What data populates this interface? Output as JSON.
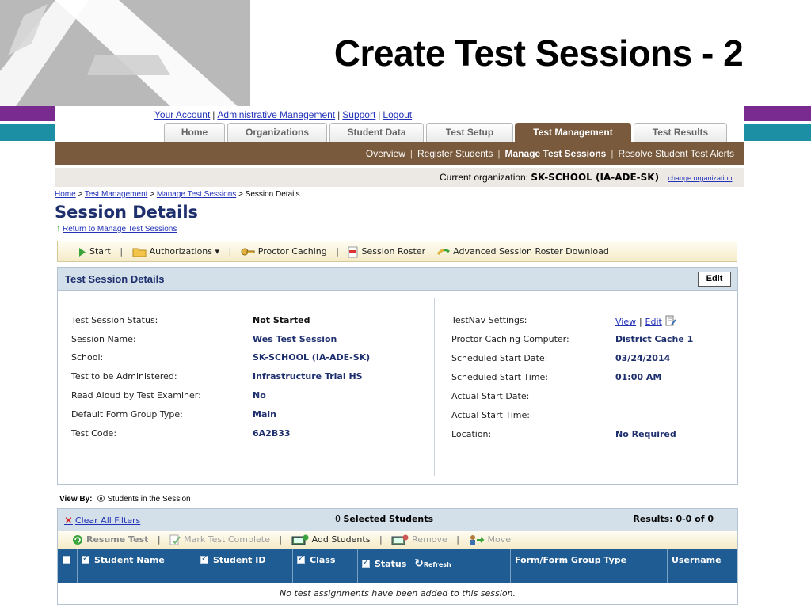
{
  "slide": {
    "title": "Create Test Sessions - 2"
  },
  "top_links": [
    "Your Account",
    "Administrative Management",
    "Support",
    "Logout"
  ],
  "tabs": [
    {
      "label": "Home",
      "active": false
    },
    {
      "label": "Organizations",
      "active": false
    },
    {
      "label": "Student Data",
      "active": false
    },
    {
      "label": "Test Setup",
      "active": false
    },
    {
      "label": "Test Management",
      "active": true
    },
    {
      "label": "Test Results",
      "active": false
    }
  ],
  "subnav": {
    "items": [
      "Overview",
      "Register Students",
      "Manage Test Sessions",
      "Resolve Student Test Alerts"
    ],
    "active": "Manage Test Sessions"
  },
  "org_bar": {
    "label": "Current organization:",
    "value": "SK-SCHOOL (IA-ADE-SK)",
    "change_link": "change organization"
  },
  "breadcrumb": {
    "items": [
      "Home",
      "Test Management",
      "Manage Test Sessions"
    ],
    "current": "Session Details",
    "separator": ">"
  },
  "page": {
    "title": "Session Details",
    "return_link": "Return to Manage Test Sessions"
  },
  "toolbar": {
    "start": "Start",
    "authorizations": "Authorizations",
    "proctor_caching": "Proctor Caching",
    "session_roster": "Session Roster",
    "advanced_roster": "Advanced Session Roster Download"
  },
  "details": {
    "header": "Test Session Details",
    "edit": "Edit",
    "left": [
      {
        "label": "Test Session Status:",
        "value": "Not Started"
      },
      {
        "label": "Session Name:",
        "value": "Wes Test Session"
      },
      {
        "label": "School:",
        "value": "SK-SCHOOL (IA-ADE-SK)"
      },
      {
        "label": "Test to be Administered:",
        "value": "Infrastructure Trial HS"
      },
      {
        "label": "Read Aloud by Test Examiner:",
        "value": "No"
      },
      {
        "label": "Default Form Group Type:",
        "value": "Main"
      },
      {
        "label": "Test Code:",
        "value": "6A2B33"
      }
    ],
    "right": [
      {
        "label": "TestNav Settings:",
        "value": ""
      },
      {
        "label": "Proctor Caching Computer:",
        "value": "District Cache 1"
      },
      {
        "label": "Scheduled Start Date:",
        "value": "03/24/2014"
      },
      {
        "label": "Scheduled Start Time:",
        "value": "01:00 AM"
      },
      {
        "label": "Actual Start Date:",
        "value": ""
      },
      {
        "label": "Actual Start Time:",
        "value": ""
      },
      {
        "label": "Location:",
        "value": "No Required"
      }
    ],
    "testnav_links": {
      "view": "View",
      "separator": "|",
      "edit": "Edit"
    }
  },
  "view_by": {
    "label": "View By:",
    "option": "Students in the Session"
  },
  "grid": {
    "clear_filters": "Clear All Filters",
    "selected_count": "0",
    "selected_label": "Selected Students",
    "results": "Results: 0-0 of 0",
    "tools": {
      "resume": "Resume Test",
      "mark_complete": "Mark Test Complete",
      "add_students": "Add Students",
      "remove": "Remove",
      "move": "Move"
    },
    "columns": [
      "Student Name",
      "Student ID",
      "Class",
      "Status",
      "Form/Form Group Type",
      "Username"
    ],
    "refresh": "Refresh",
    "empty_message": "No test assignments have been added to this session."
  },
  "colors": {
    "brand_purple": "#7a2b8f",
    "brand_teal": "#1c8fa5",
    "nav_brown": "#7a5a3d",
    "header_navy": "#1e2f6e",
    "grid_head": "#1f5c93",
    "panel_blue": "#d3dfe9"
  },
  "icons": [
    "logo-a-icon",
    "play-icon",
    "folder-icon",
    "key-icon",
    "pdf-icon",
    "download-arrow-icon",
    "filter-clear-icon",
    "resume-icon",
    "mark-complete-icon",
    "add-students-icon",
    "remove-icon",
    "move-icon",
    "refresh-icon",
    "return-arrow-icon",
    "page-edit-icon"
  ]
}
